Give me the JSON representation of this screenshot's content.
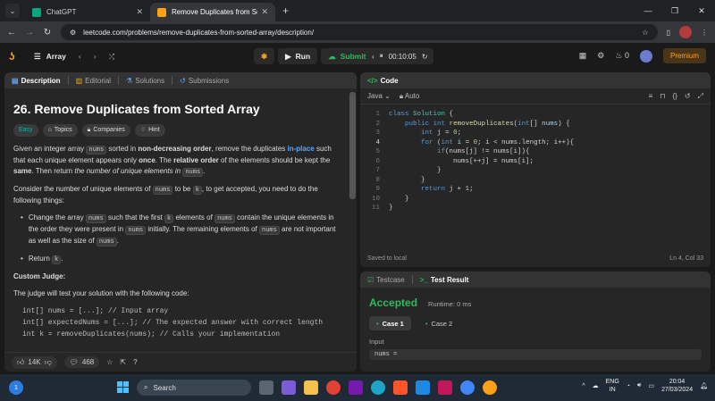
{
  "browser": {
    "tabs": [
      {
        "title": "ChatGPT",
        "color": "#10a37f"
      },
      {
        "title": "Remove Duplicates from Sorted",
        "color": "#ffa116"
      }
    ],
    "url": "leetcode.com/problems/remove-duplicates-from-sorted-array/description/"
  },
  "nav": {
    "problem_list": "Array",
    "run": "Run",
    "submit": "Submit",
    "timer": "00:10:05",
    "streak": "0",
    "premium": "Premium"
  },
  "desc": {
    "tabs": [
      "Description",
      "Editorial",
      "Solutions",
      "Submissions"
    ],
    "title": "26. Remove Duplicates from Sorted Array",
    "tags": [
      "Easy",
      "Topics",
      "Companies",
      "Hint"
    ],
    "p1": {
      "a": "Given an integer array ",
      "nums1": "nums",
      "b": " sorted in ",
      "bold1": "non-decreasing order",
      "c": ", remove the duplicates ",
      "inplace": "in-place",
      "d": " such that each unique element appears only ",
      "once": "once",
      "e": ". The ",
      "relorder": "relative order",
      "f": " of the elements should be kept the ",
      "same": "same",
      "g": ". Then return ",
      "italic": "the number of unique elements in",
      "nums2": "nums",
      "h": "."
    },
    "p2": {
      "a": "Consider the number of unique elements of ",
      "nums": "nums",
      "b": " to be ",
      "k": "k",
      "c": ", to get accepted, you need to do the following things:"
    },
    "b1": {
      "a": "Change the array ",
      "nums1": "nums",
      "b": " such that the first ",
      "k": "k",
      "c": " elements of ",
      "nums2": "nums",
      "d": " contain the unique elements in the order they were present in ",
      "nums3": "nums",
      "e": " initially. The remaining elements of ",
      "nums4": "nums",
      "f": " are not important as well as the size of ",
      "nums5": "nums",
      "g": "."
    },
    "b2": {
      "a": "Return ",
      "k": "k",
      "b": "."
    },
    "judge_title": "Custom Judge:",
    "judge_text": "The judge will test your solution with the following code:",
    "code_lines": [
      "int[] nums = [...]; // Input array",
      "int[] expectedNums = [...]; // The expected answer with correct length",
      "",
      "int k = removeDuplicates(nums); // Calls your implementation"
    ],
    "likes": "14K",
    "comments": "468"
  },
  "code": {
    "title": "Code",
    "lang": "Java",
    "mode": "Auto",
    "line_numbers": [
      "1",
      "2",
      "3",
      "4",
      "5",
      "6",
      "7",
      "8",
      "9",
      "10",
      "11"
    ],
    "saved": "Saved to local",
    "position": "Ln 4, Col 33"
  },
  "result": {
    "tab_testcase": "Testcase",
    "tab_result": "Test Result",
    "status": "Accepted",
    "runtime": "Runtime: 0 ms",
    "cases": [
      "Case 1",
      "Case 2"
    ],
    "input_label": "Input",
    "input_value": "nums ="
  },
  "taskbar": {
    "search": "Search",
    "lang_top": "ENG",
    "lang_bottom": "IN",
    "time": "20:04",
    "date": "27/03/2024",
    "notif": "1"
  }
}
